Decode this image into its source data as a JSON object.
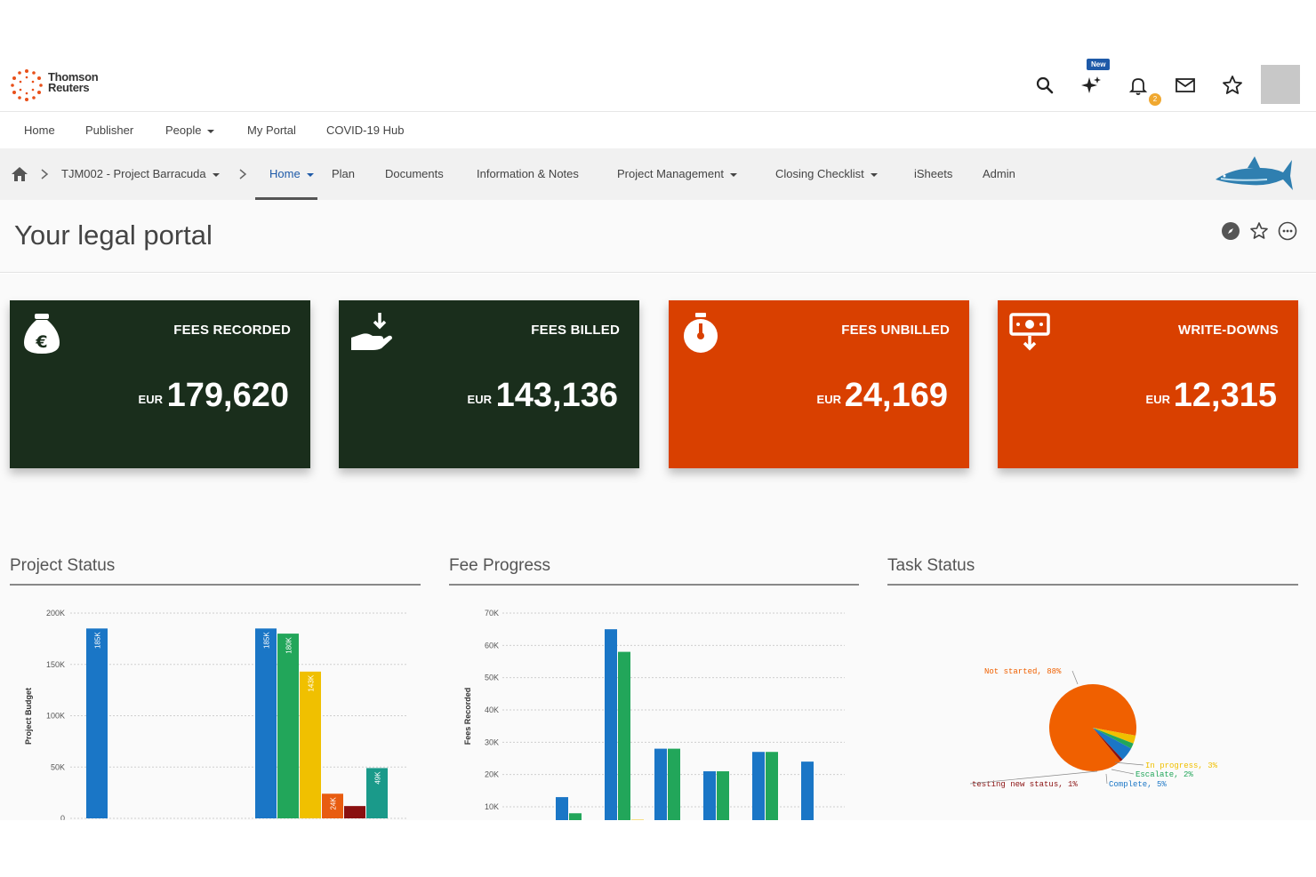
{
  "header": {
    "logo_line1": "Thomson",
    "logo_line2": "Reuters",
    "new_badge": "New",
    "notification_count": "2",
    "icons": [
      "search-icon",
      "sparkle-ai-icon",
      "bell-icon",
      "mail-icon",
      "star-icon"
    ]
  },
  "main_nav": {
    "items": [
      "Home",
      "Publisher",
      "People",
      "My Portal",
      "COVID-19 Hub"
    ]
  },
  "sub_nav": {
    "project": "TJM002 - Project Barracuda",
    "items": [
      "Home",
      "Plan",
      "Documents",
      "Information & Notes",
      "Project Management",
      "Closing Checklist",
      "iSheets",
      "Admin"
    ],
    "active": "Home"
  },
  "page": {
    "title": "Your legal portal"
  },
  "cards": [
    {
      "label": "FEES RECORDED",
      "currency": "EUR",
      "value": "179,620",
      "color": "#1a2e1c",
      "icon": "money-bag-euro-icon"
    },
    {
      "label": "FEES BILLED",
      "currency": "EUR",
      "value": "143,136",
      "color": "#1a2e1c",
      "icon": "hand-receive-icon"
    },
    {
      "label": "FEES UNBILLED",
      "currency": "EUR",
      "value": "24,169",
      "color": "#d94000",
      "icon": "stopwatch-icon"
    },
    {
      "label": "WRITE-DOWNS",
      "currency": "EUR",
      "value": "12,315",
      "color": "#d94000",
      "icon": "cash-down-icon"
    }
  ],
  "sections": {
    "project_status": "Project Status",
    "fee_progress": "Fee Progress",
    "task_status": "Task Status"
  },
  "chart_data": [
    {
      "type": "bar",
      "title": "Project Status",
      "ylabel": "Project Budget",
      "ylim": [
        0,
        200000
      ],
      "y_ticks": [
        "0",
        "50K",
        "100K",
        "150K",
        "200K"
      ],
      "groups": [
        {
          "bars": [
            {
              "value": 185000,
              "label": "185K",
              "color": "#1a76c6"
            }
          ]
        },
        {
          "bars": [
            {
              "value": 185000,
              "label": "185K",
              "color": "#1a76c6"
            },
            {
              "value": 180000,
              "label": "180K",
              "color": "#22a65a"
            },
            {
              "value": 143000,
              "label": "143K",
              "color": "#f0c000"
            },
            {
              "value": 24000,
              "label": "24K",
              "color": "#e85c10"
            },
            {
              "value": 12000,
              "label": "",
              "color": "#8a1010"
            },
            {
              "value": 49000,
              "label": "49K",
              "color": "#1a9a8a"
            }
          ]
        }
      ]
    },
    {
      "type": "bar",
      "title": "Fee Progress",
      "ylabel": "Fees Recorded",
      "ylim": [
        0,
        70000
      ],
      "y_ticks": [
        "10K",
        "20K",
        "30K",
        "40K",
        "50K",
        "60K",
        "70K"
      ],
      "series": [
        {
          "color": "#1a76c6",
          "values": [
            13000,
            65000,
            28000,
            21000,
            27000,
            24000
          ]
        },
        {
          "color": "#22a65a",
          "values": [
            8000,
            58000,
            28000,
            21000,
            27000,
            0
          ]
        },
        {
          "color": "#f0c000",
          "values": [
            0,
            6000,
            0,
            0,
            0,
            0
          ]
        }
      ]
    },
    {
      "type": "pie",
      "title": "Task Status",
      "slices": [
        {
          "label": "Not started, 88%",
          "value": 88,
          "color": "#f06000"
        },
        {
          "label": "In progress, 3%",
          "value": 3,
          "color": "#f0c000"
        },
        {
          "label": "Escalate, 2%",
          "value": 2,
          "color": "#22a65a"
        },
        {
          "label": "Complete, 5%",
          "value": 5,
          "color": "#1a76c6"
        },
        {
          "label": "testing new status, 1%",
          "value": 1,
          "color": "#8a1010"
        }
      ]
    }
  ]
}
